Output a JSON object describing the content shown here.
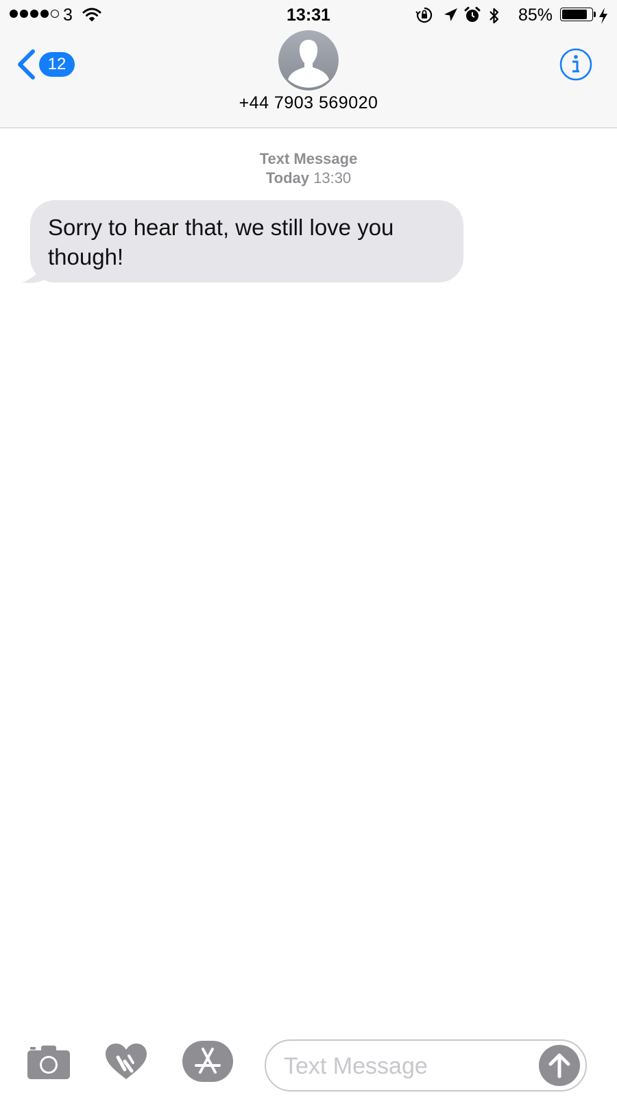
{
  "status_bar": {
    "carrier": "3",
    "time": "13:31",
    "battery_percent": "85%",
    "battery_level": 0.85,
    "signal_bars": 4,
    "signal_total": 5
  },
  "nav": {
    "back_count": "12",
    "contact": "+44 7903 569020",
    "accent": "#147efb"
  },
  "thread": {
    "service_label": "Text Message",
    "day_label": "Today",
    "time_label": "13:30",
    "messages": [
      {
        "direction": "incoming",
        "text": "Sorry to hear that, we still love you though!"
      }
    ]
  },
  "composer": {
    "placeholder": "Text Message"
  },
  "icons": [
    "back-chevron-icon",
    "person-icon",
    "info-icon",
    "camera-icon",
    "digital-touch-heart-icon",
    "app-store-icon",
    "send-arrow-icon",
    "wifi-icon",
    "orientation-lock-icon",
    "location-arrow-icon",
    "alarm-icon",
    "bluetooth-icon",
    "battery-icon",
    "charging-bolt-icon"
  ]
}
